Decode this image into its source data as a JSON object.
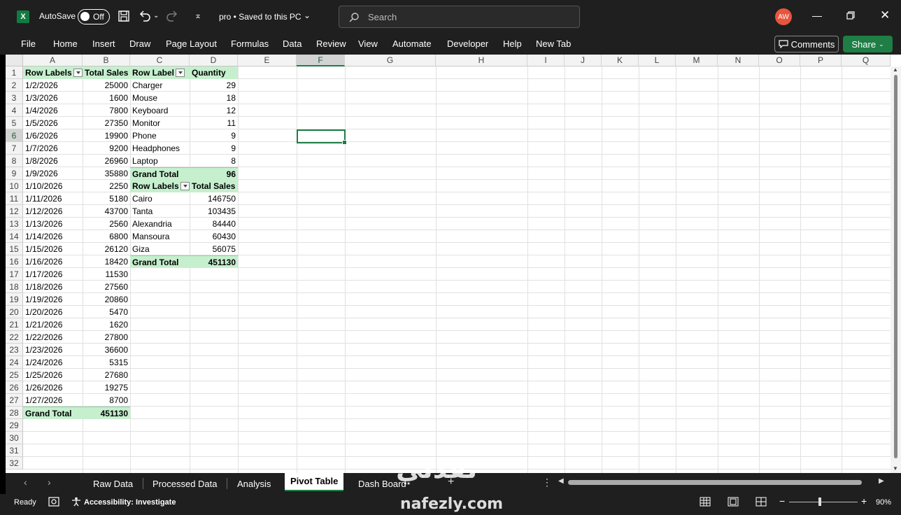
{
  "titlebar": {
    "autosave_label": "AutoSave",
    "autosave_state": "Off",
    "doc_title": "pro • Saved to this PC",
    "search_placeholder": "Search",
    "avatar_initials": "AW"
  },
  "ribbon": {
    "tabs": [
      "File",
      "Home",
      "Insert",
      "Draw",
      "Page Layout",
      "Formulas",
      "Data",
      "Review",
      "View",
      "Automate",
      "Developer",
      "Help",
      "New Tab"
    ],
    "comments_label": "Comments",
    "share_label": "Share"
  },
  "grid": {
    "columns": [
      "A",
      "B",
      "C",
      "D",
      "E",
      "F",
      "G",
      "H",
      "I",
      "J",
      "K",
      "L",
      "M",
      "N",
      "O",
      "P",
      "Q"
    ],
    "selected_column": "F",
    "selected_row": 6,
    "rows": [
      "1",
      "2",
      "3",
      "4",
      "5",
      "6",
      "7",
      "8",
      "9",
      "10",
      "11",
      "12",
      "13",
      "14",
      "15",
      "16",
      "17",
      "18",
      "19",
      "20",
      "21",
      "22",
      "23",
      "24",
      "25",
      "26",
      "27",
      "28",
      "29",
      "30",
      "31",
      "32"
    ]
  },
  "pivot_dates": {
    "header_label": "Row Labels",
    "header_value": "Total Sales",
    "rows": [
      [
        "1/2/2026",
        "25000"
      ],
      [
        "1/3/2026",
        "1600"
      ],
      [
        "1/4/2026",
        "7800"
      ],
      [
        "1/5/2026",
        "27350"
      ],
      [
        "1/6/2026",
        "19900"
      ],
      [
        "1/7/2026",
        "9200"
      ],
      [
        "1/8/2026",
        "26960"
      ],
      [
        "1/9/2026",
        "35880"
      ],
      [
        "1/10/2026",
        "2250"
      ],
      [
        "1/11/2026",
        "5180"
      ],
      [
        "1/12/2026",
        "43700"
      ],
      [
        "1/13/2026",
        "2560"
      ],
      [
        "1/14/2026",
        "6800"
      ],
      [
        "1/15/2026",
        "26120"
      ],
      [
        "1/16/2026",
        "18420"
      ],
      [
        "1/17/2026",
        "11530"
      ],
      [
        "1/18/2026",
        "27560"
      ],
      [
        "1/19/2026",
        "20860"
      ],
      [
        "1/20/2026",
        "5470"
      ],
      [
        "1/21/2026",
        "1620"
      ],
      [
        "1/22/2026",
        "27800"
      ],
      [
        "1/23/2026",
        "36600"
      ],
      [
        "1/24/2026",
        "5315"
      ],
      [
        "1/25/2026",
        "27680"
      ],
      [
        "1/26/2026",
        "19275"
      ],
      [
        "1/27/2026",
        "8700"
      ]
    ],
    "total_label": "Grand Total",
    "total_value": "451130"
  },
  "pivot_products": {
    "header_label": "Row Label",
    "header_value": "Quantity",
    "rows": [
      [
        "Charger",
        "29"
      ],
      [
        "Mouse",
        "18"
      ],
      [
        "Keyboard",
        "12"
      ],
      [
        "Monitor",
        "11"
      ],
      [
        "Phone",
        "9"
      ],
      [
        "Headphones",
        "9"
      ],
      [
        "Laptop",
        "8"
      ]
    ],
    "total_label": "Grand Total",
    "total_value": "96"
  },
  "pivot_cities": {
    "header_label": "Row Labels",
    "header_value": "Total Sales",
    "rows": [
      [
        "Cairo",
        "146750"
      ],
      [
        "Tanta",
        "103435"
      ],
      [
        "Alexandria",
        "84440"
      ],
      [
        "Mansoura",
        "60430"
      ],
      [
        "Giza",
        "56075"
      ]
    ],
    "total_label": "Grand Total",
    "total_value": "451130"
  },
  "sheet_tabs": [
    "Raw Data",
    "Processed Data",
    "Analysis",
    "Pivot Table",
    "Dash Board"
  ],
  "active_sheet": "Pivot Table",
  "status": {
    "ready": "Ready",
    "accessibility": "Accessibility: Investigate",
    "zoom": "90%"
  },
  "watermark": {
    "arabic": "نفذلي",
    "latin": "nafezly.com"
  }
}
